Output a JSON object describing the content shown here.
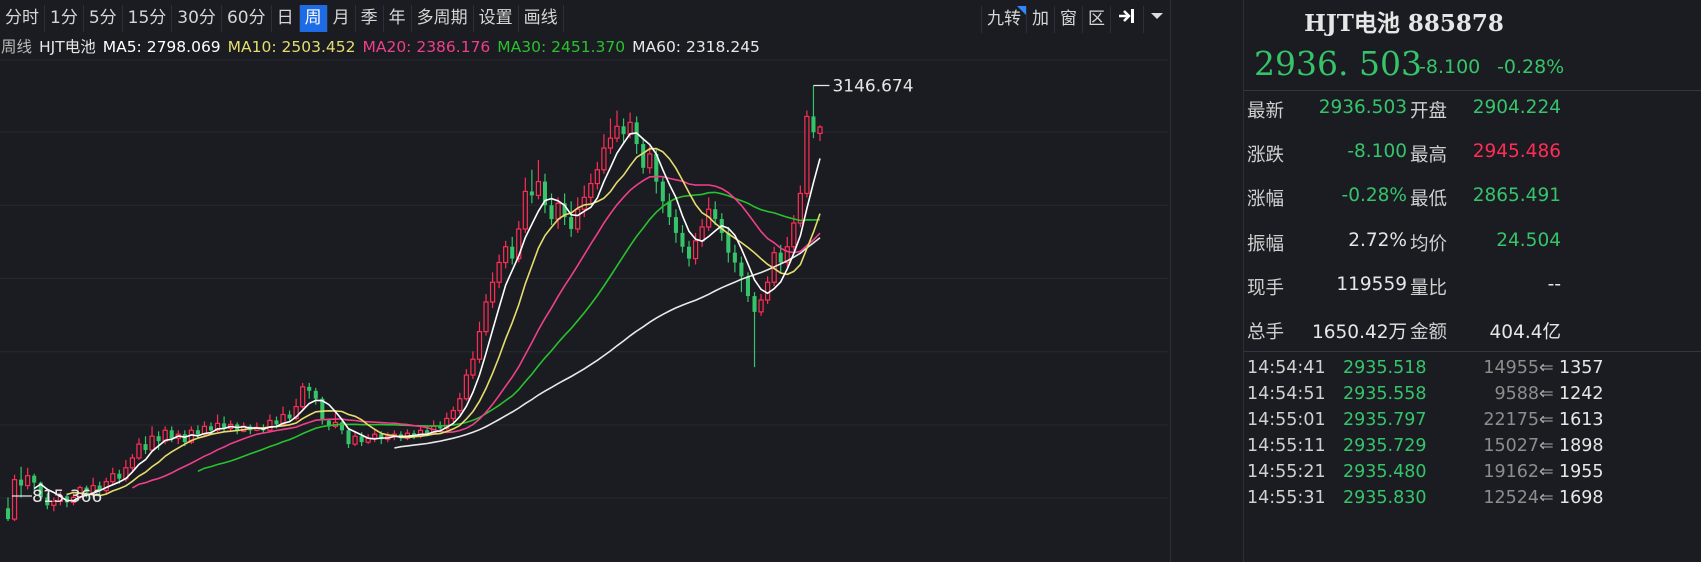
{
  "toolbar": {
    "periods": [
      "分时",
      "1分",
      "5分",
      "15分",
      "30分",
      "60分",
      "日",
      "周",
      "月",
      "季",
      "年",
      "多周期",
      "设置",
      "画线"
    ],
    "active_period": "周",
    "right_buttons": [
      "九转",
      "加",
      "窗",
      "区"
    ]
  },
  "ma_row": {
    "period_label": "周线",
    "stock_name": "HJT电池",
    "ma5": "MA5: 2798.069",
    "ma10": "MA10: 2503.452",
    "ma20": "MA20: 2386.176",
    "ma30": "MA30: 2451.370",
    "ma60": "MA60: 2318.245"
  },
  "colors": {
    "up": "#ff2d55",
    "down": "#36c46a",
    "ma5": "#ffffff",
    "ma10": "#e6dc6e",
    "ma20": "#ef3f8a",
    "ma30": "#29c22f",
    "ma60": "#e8e8e8",
    "active_tab": "#1d6be5"
  },
  "chart_data": {
    "type": "candlestick",
    "y_ticks": [
      "3276",
      "2911",
      "2540",
      "2169",
      "1798",
      "1427",
      "1057"
    ],
    "high_label": "3146.674",
    "low_label": "815.366",
    "candles": [
      [
        1005,
        950,
        1060,
        940
      ],
      [
        950,
        1150,
        1175,
        940
      ],
      [
        1150,
        1120,
        1215,
        1060
      ],
      [
        1120,
        1170,
        1210,
        1100
      ],
      [
        1170,
        1135,
        1180,
        1095
      ],
      [
        1135,
        1060,
        1140,
        1040
      ],
      [
        1060,
        1020,
        1080,
        1000
      ],
      [
        1020,
        1040,
        1060,
        990
      ],
      [
        1040,
        1065,
        1090,
        1020
      ],
      [
        1065,
        1035,
        1080,
        1010
      ],
      [
        1035,
        1060,
        1080,
        1020
      ],
      [
        1060,
        1110,
        1120,
        1050
      ],
      [
        1110,
        1085,
        1120,
        1060
      ],
      [
        1085,
        1120,
        1160,
        1070
      ],
      [
        1120,
        1095,
        1140,
        1070
      ],
      [
        1095,
        1140,
        1160,
        1080
      ],
      [
        1140,
        1180,
        1210,
        1125
      ],
      [
        1180,
        1155,
        1200,
        1130
      ],
      [
        1155,
        1210,
        1250,
        1140
      ],
      [
        1210,
        1260,
        1280,
        1190
      ],
      [
        1260,
        1330,
        1360,
        1250
      ],
      [
        1330,
        1300,
        1370,
        1280
      ],
      [
        1300,
        1370,
        1420,
        1290
      ],
      [
        1370,
        1345,
        1395,
        1300
      ],
      [
        1345,
        1400,
        1420,
        1330
      ],
      [
        1400,
        1360,
        1420,
        1340
      ],
      [
        1360,
        1380,
        1400,
        1330
      ],
      [
        1380,
        1340,
        1400,
        1320
      ],
      [
        1340,
        1400,
        1420,
        1330
      ],
      [
        1400,
        1380,
        1425,
        1360
      ],
      [
        1380,
        1420,
        1445,
        1370
      ],
      [
        1420,
        1400,
        1440,
        1385
      ],
      [
        1400,
        1435,
        1480,
        1390
      ],
      [
        1435,
        1410,
        1470,
        1390
      ],
      [
        1410,
        1430,
        1450,
        1395
      ],
      [
        1430,
        1395,
        1440,
        1380
      ],
      [
        1395,
        1420,
        1440,
        1390
      ],
      [
        1420,
        1400,
        1430,
        1380
      ],
      [
        1400,
        1415,
        1440,
        1395
      ],
      [
        1415,
        1400,
        1430,
        1385
      ],
      [
        1400,
        1450,
        1480,
        1395
      ],
      [
        1450,
        1430,
        1470,
        1410
      ],
      [
        1430,
        1480,
        1520,
        1425
      ],
      [
        1480,
        1460,
        1500,
        1440
      ],
      [
        1460,
        1520,
        1560,
        1450
      ],
      [
        1520,
        1620,
        1640,
        1510
      ],
      [
        1620,
        1600,
        1640,
        1560
      ],
      [
        1600,
        1560,
        1615,
        1530
      ],
      [
        1560,
        1450,
        1570,
        1430
      ],
      [
        1450,
        1420,
        1460,
        1400
      ],
      [
        1420,
        1440,
        1500,
        1410
      ],
      [
        1440,
        1400,
        1450,
        1380
      ],
      [
        1400,
        1330,
        1410,
        1310
      ],
      [
        1330,
        1370,
        1390,
        1320
      ],
      [
        1370,
        1340,
        1390,
        1320
      ],
      [
        1340,
        1360,
        1380,
        1330
      ],
      [
        1360,
        1380,
        1400,
        1340
      ],
      [
        1380,
        1355,
        1395,
        1330
      ],
      [
        1355,
        1370,
        1390,
        1340
      ],
      [
        1370,
        1380,
        1400,
        1350
      ],
      [
        1380,
        1360,
        1395,
        1345
      ],
      [
        1360,
        1385,
        1405,
        1350
      ],
      [
        1385,
        1370,
        1400,
        1355
      ],
      [
        1370,
        1400,
        1420,
        1360
      ],
      [
        1400,
        1385,
        1415,
        1370
      ],
      [
        1385,
        1420,
        1450,
        1380
      ],
      [
        1420,
        1410,
        1445,
        1390
      ],
      [
        1410,
        1460,
        1490,
        1400
      ],
      [
        1460,
        1500,
        1520,
        1440
      ],
      [
        1500,
        1560,
        1590,
        1480
      ],
      [
        1560,
        1680,
        1710,
        1550
      ],
      [
        1680,
        1760,
        1800,
        1660
      ],
      [
        1760,
        1900,
        1950,
        1740
      ],
      [
        1900,
        2050,
        2090,
        1880
      ],
      [
        2050,
        2150,
        2200,
        2020
      ],
      [
        2150,
        2250,
        2290,
        2120
      ],
      [
        2250,
        2330,
        2360,
        2220
      ],
      [
        2330,
        2270,
        2380,
        2240
      ],
      [
        2270,
        2420,
        2460,
        2250
      ],
      [
        2420,
        2610,
        2680,
        2400
      ],
      [
        2610,
        2590,
        2720,
        2550
      ],
      [
        2590,
        2660,
        2770,
        2570
      ],
      [
        2660,
        2540,
        2700,
        2500
      ],
      [
        2540,
        2470,
        2600,
        2440
      ],
      [
        2470,
        2550,
        2580,
        2420
      ],
      [
        2550,
        2480,
        2600,
        2440
      ],
      [
        2480,
        2420,
        2560,
        2380
      ],
      [
        2420,
        2520,
        2580,
        2400
      ],
      [
        2520,
        2580,
        2640,
        2480
      ],
      [
        2580,
        2650,
        2700,
        2550
      ],
      [
        2650,
        2720,
        2760,
        2620
      ],
      [
        2720,
        2830,
        2900,
        2700
      ],
      [
        2830,
        2880,
        2980,
        2800
      ],
      [
        2880,
        2940,
        3020,
        2860
      ],
      [
        2940,
        2900,
        2980,
        2850
      ],
      [
        2900,
        2960,
        3010,
        2880
      ],
      [
        2960,
        2850,
        2990,
        2800
      ],
      [
        2850,
        2730,
        2880,
        2700
      ],
      [
        2730,
        2800,
        2840,
        2700
      ],
      [
        2800,
        2660,
        2820,
        2600
      ],
      [
        2660,
        2560,
        2680,
        2500
      ],
      [
        2560,
        2480,
        2600,
        2440
      ],
      [
        2480,
        2400,
        2520,
        2350
      ],
      [
        2400,
        2330,
        2440,
        2300
      ],
      [
        2330,
        2270,
        2360,
        2230
      ],
      [
        2270,
        2360,
        2400,
        2240
      ],
      [
        2360,
        2430,
        2470,
        2330
      ],
      [
        2430,
        2520,
        2580,
        2410
      ],
      [
        2520,
        2470,
        2560,
        2440
      ],
      [
        2470,
        2400,
        2500,
        2360
      ],
      [
        2400,
        2300,
        2430,
        2250
      ],
      [
        2300,
        2250,
        2340,
        2200
      ],
      [
        2250,
        2180,
        2280,
        2100
      ],
      [
        2180,
        2080,
        2200,
        2050
      ],
      [
        2080,
        2000,
        2100,
        1720
      ],
      [
        2000,
        2060,
        2090,
        1980
      ],
      [
        2060,
        2150,
        2180,
        2040
      ],
      [
        2150,
        2300,
        2330,
        2130
      ],
      [
        2300,
        2250,
        2340,
        2200
      ],
      [
        2250,
        2330,
        2380,
        2230
      ],
      [
        2330,
        2450,
        2490,
        2310
      ],
      [
        2450,
        2600,
        2640,
        2430
      ],
      [
        2600,
        2990,
        3020,
        2580
      ],
      [
        2990,
        2910,
        3146.674,
        2880
      ],
      [
        2904.224,
        2936.503,
        2945.486,
        2865.491
      ]
    ]
  },
  "quote": {
    "title": "HJT电池 885878",
    "price": "2936. 503",
    "change": "-8.100",
    "change_pct": "-0.28%",
    "rows": [
      {
        "l1": "最新",
        "v1": "2936.503",
        "c1": "green",
        "l2": "开盘",
        "v2": "2904.224",
        "c2": "green"
      },
      {
        "l1": "涨跌",
        "v1": "-8.100",
        "c1": "green",
        "l2": "最高",
        "v2": "2945.486",
        "c2": "red"
      },
      {
        "l1": "涨幅",
        "v1": "-0.28%",
        "c1": "green",
        "l2": "最低",
        "v2": "2865.491",
        "c2": "green"
      },
      {
        "l1": "振幅",
        "v1": "2.72%",
        "c1": "white",
        "l2": "均价",
        "v2": "24.504",
        "c2": "green"
      },
      {
        "l1": "现手",
        "v1": "119559",
        "c1": "white",
        "l2": "量比",
        "v2": "--",
        "c2": "white"
      },
      {
        "l1": "总手",
        "v1": "1650.42万",
        "c1": "white",
        "l2": "金额",
        "v2": "404.4亿",
        "c2": "white"
      }
    ]
  },
  "ticks": [
    {
      "time": "14:54:41",
      "price": "2935.518",
      "vol": "14955",
      "arrow": "⇐",
      "num": "1357"
    },
    {
      "time": "14:54:51",
      "price": "2935.558",
      "vol": "9588",
      "arrow": "⇐",
      "num": "1242"
    },
    {
      "time": "14:55:01",
      "price": "2935.797",
      "vol": "22175",
      "arrow": "⇐",
      "num": "1613"
    },
    {
      "time": "14:55:11",
      "price": "2935.729",
      "vol": "15027",
      "arrow": "⇐",
      "num": "1898"
    },
    {
      "time": "14:55:21",
      "price": "2935.480",
      "vol": "19162",
      "arrow": "⇐",
      "num": "1955"
    },
    {
      "time": "14:55:31",
      "price": "2935.830",
      "vol": "12524",
      "arrow": "⇐",
      "num": "1698"
    }
  ]
}
